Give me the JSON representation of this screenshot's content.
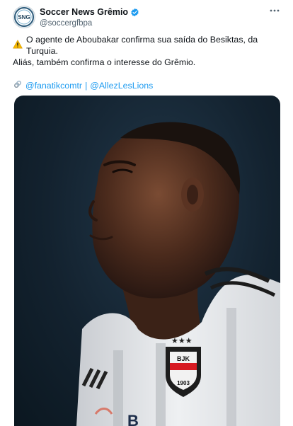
{
  "author": {
    "display_name": "Soccer News Grêmio",
    "handle": "@soccergfbpa",
    "avatar_text": "SNG"
  },
  "tweet": {
    "line1": "O agente de Aboubakar confirma sua saída do Besiktas, da Turquia.",
    "line2": "Aliás, também confirma o interesse do Grêmio.",
    "mention1": "@fanatikcomtr",
    "separator": "|",
    "mention2": "@AllezLesLions"
  },
  "media": {
    "crest_letters": "BJK",
    "crest_year": "1903"
  },
  "colors": {
    "link": "#1d9bf0",
    "verified": "#1d9bf0",
    "secondary_text": "#536471",
    "warning": "#f5b800"
  },
  "icons": [
    "verified-badge-icon",
    "more-options-icon",
    "warning-icon",
    "link-icon"
  ]
}
